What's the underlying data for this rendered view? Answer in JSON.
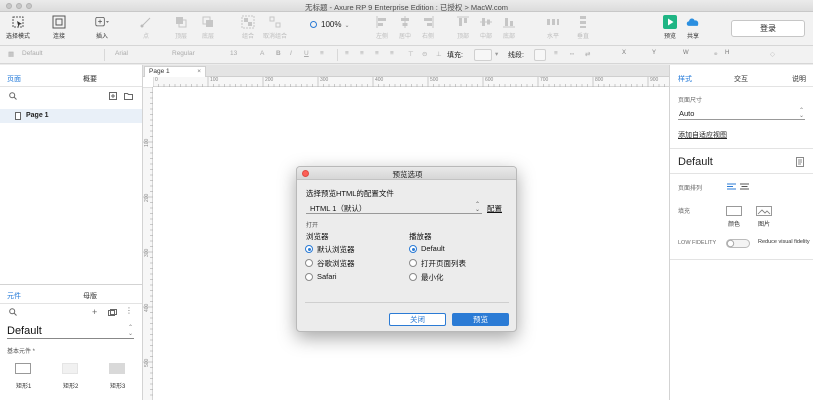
{
  "window": {
    "title": "无标题 - Axure RP 9 Enterprise Edition : 已授权 > MacW.com"
  },
  "toolbar": {
    "select_mode": "选择模式",
    "connect": "连接",
    "insert": "插入",
    "point": "点",
    "top_layer": "顶层",
    "bottom_layer": "底层",
    "group": "组合",
    "ungroup": "取消组合",
    "zoom": "100%",
    "left": "左侧",
    "center": "居中",
    "right": "右侧",
    "top": "顶部",
    "middle": "中部",
    "bottom": "底部",
    "horizontal": "水平",
    "vertical": "垂直",
    "preview": "预览",
    "share": "共享",
    "login": "登录",
    "colors": {
      "preview_icon": "#1fb584",
      "share_icon": "#2b8fe0",
      "accent": "#2b7bd5"
    }
  },
  "formatbar": {
    "style": "Default",
    "font": "Arial",
    "weight": "Regular",
    "size": "13",
    "fill_label": "填充:",
    "line_label": "线段:",
    "x_label": "X",
    "y_label": "Y",
    "w_label": "W",
    "h_label": "H"
  },
  "left_panel": {
    "tab_pages": "页面",
    "tab_outline": "概要",
    "page_item": "Page 1",
    "tab_widgets": "元件",
    "tab_masters": "母版",
    "library": "Default",
    "section": "基本元件 *",
    "widgets": [
      "矩形1",
      "矩形2",
      "矩形3"
    ]
  },
  "canvas": {
    "page_tab": "Page 1",
    "ruler_h": [
      "0",
      "100",
      "200",
      "300",
      "400",
      "500",
      "600",
      "700",
      "800",
      "900"
    ],
    "ruler_v": [
      "100",
      "200",
      "300",
      "400",
      "500"
    ]
  },
  "right_panel": {
    "tab_style": "样式",
    "tab_interact": "交互",
    "tab_notes": "说明",
    "page_size_label": "页面尺寸",
    "page_size_value": "Auto",
    "add_adaptive": "添加自适应视图",
    "style_name": "Default",
    "page_arrange_label": "页面排列",
    "fill_label": "填充",
    "fill_color": "颜色",
    "fill_image": "图片",
    "low_fidelity": "LOW FIDELITY",
    "reduce_fidelity": "Reduce visual fidelity"
  },
  "dialog": {
    "title": "预览选项",
    "config_label": "选择预览HTML的配置文件",
    "profile_value": "HTML 1（默认）",
    "config_link": "配置",
    "open_label": "打开",
    "browser_label": "浏览器",
    "browser_options": [
      "默认浏览器",
      "谷歌浏览器",
      "Safari"
    ],
    "player_label": "播放器",
    "player_options": [
      "Default",
      "打开页面列表",
      "最小化"
    ],
    "cancel": "关闭",
    "preview": "预览"
  }
}
